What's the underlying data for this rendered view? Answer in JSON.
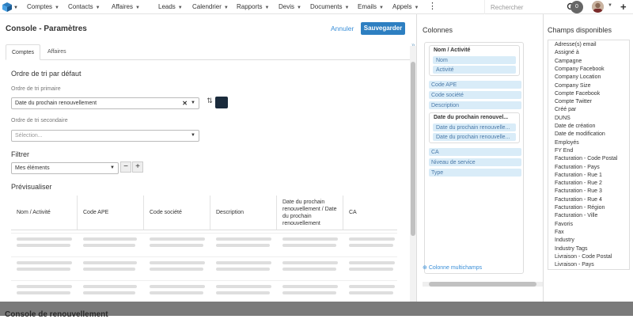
{
  "topnav": {
    "items": [
      "Comptes",
      "Contacts",
      "Affaires",
      "Leads",
      "Calendrier",
      "Rapports",
      "Devis",
      "Documents",
      "Emails",
      "Appels"
    ],
    "search_placeholder": "Rechercher",
    "notif_count": "0"
  },
  "header": {
    "title": "Console - Paramètres",
    "cancel_label": "Annuler",
    "save_label": "Sauvegarder"
  },
  "tabs": [
    "Comptes",
    "Affaires"
  ],
  "sort": {
    "section_title": "Ordre de tri par défaut",
    "primary_label": "Ordre de tri primaire",
    "primary_value": "Date du prochain renouvellement",
    "secondary_label": "Ordre de tri secondaire",
    "secondary_placeholder": "Sélection..."
  },
  "filter": {
    "section_title": "Filtrer",
    "value": "Mes éléments"
  },
  "preview": {
    "section_title": "Prévisualiser",
    "columns": [
      "Nom / Activité",
      "Code APE",
      "Code société",
      "Description",
      "Date du prochain renouvellement / Date du prochain renouvellement",
      "CA"
    ]
  },
  "columns_panel": {
    "title": "Colonnes",
    "group1": {
      "title": "Nom / Activité",
      "fields": [
        "Nom",
        "Activité"
      ]
    },
    "mid_fields": [
      "Code APE",
      "Code société",
      "Description"
    ],
    "group2": {
      "title": "Date du prochain renouvel...",
      "fields": [
        "Date du prochain renouvelle...",
        "Date du prochain renouvelle..."
      ]
    },
    "end_fields": [
      "CA",
      "Niveau de service",
      "Type"
    ],
    "multi_label": "Colonne multichamps"
  },
  "fields_panel": {
    "title": "Champs disponibles",
    "fields": [
      "Adresse(s) email",
      "Assigné à",
      "Campagne",
      "Company Facebook",
      "Company Location",
      "Company Size",
      "Compte Facebook",
      "Compte Twitter",
      "Créé par",
      "DUNS",
      "Date de création",
      "Date de modification",
      "Employés",
      "FY End",
      "Facturation - Code Postal",
      "Facturation - Pays",
      "Facturation - Rue 1",
      "Facturation - Rue 2",
      "Facturation - Rue 3",
      "Facturation - Rue 4",
      "Facturation - Région",
      "Facturation - Ville",
      "Favoris",
      "Fax",
      "Industry",
      "Industry Tags",
      "Livraison - Code Postal",
      "Livraison - Pays"
    ]
  },
  "bottom_bar": {
    "title": "Console de renouvellement"
  }
}
